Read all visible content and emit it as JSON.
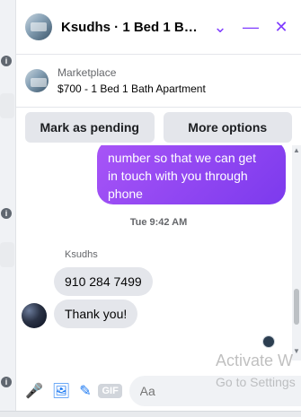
{
  "header": {
    "title": "Ksudhs · 1 Bed 1 Bath Apar…",
    "icons": [
      "chevron-down-icon",
      "minimize-icon",
      "close-icon"
    ]
  },
  "marketplace": {
    "label": "Marketplace",
    "listing": "$700 - 1 Bed 1 Bath Apartment"
  },
  "actions": {
    "mark_pending": "Mark as pending",
    "more_options": "More options"
  },
  "chat": {
    "outgoing_partial": "number so that we can get\nin touch with you through\nphone",
    "timestamp": "Tue 9:42 AM",
    "sender_name": "Ksudhs",
    "messages": [
      {
        "text": "910 284 7499"
      },
      {
        "text": "Thank you!"
      }
    ]
  },
  "composer": {
    "placeholder": "Aa",
    "gif_label": "GIF"
  },
  "watermark": {
    "line1": "Activate W",
    "line2": "Go to Settings"
  },
  "colors": {
    "accent": "#7c3aed",
    "brand_gradient_start": "#a855f7",
    "brand_gradient_end": "#7c3aed",
    "blue": "#1877f2"
  }
}
